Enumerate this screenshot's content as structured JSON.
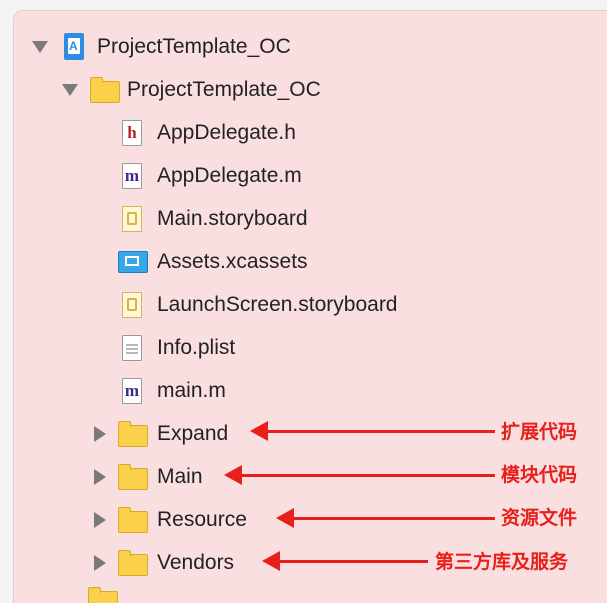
{
  "tree": {
    "project": {
      "label": "ProjectTemplate_OC",
      "icon": "xcode-project-icon"
    },
    "group": {
      "label": "ProjectTemplate_OC",
      "icon": "folder-icon"
    },
    "files": [
      {
        "label": "AppDelegate.h",
        "glyph": "h",
        "icon": "header-file-icon"
      },
      {
        "label": "AppDelegate.m",
        "glyph": "m",
        "icon": "objc-file-icon"
      },
      {
        "label": "Main.storyboard",
        "icon": "storyboard-file-icon"
      },
      {
        "label": "Assets.xcassets",
        "icon": "asset-catalog-icon"
      },
      {
        "label": "LaunchScreen.storyboard",
        "icon": "storyboard-file-icon"
      },
      {
        "label": "Info.plist",
        "icon": "plist-file-icon"
      },
      {
        "label": "main.m",
        "glyph": "m",
        "icon": "objc-file-icon"
      }
    ],
    "folders": [
      {
        "label": "Expand",
        "annotation": "扩展代码"
      },
      {
        "label": "Main",
        "annotation": "模块代码"
      },
      {
        "label": "Resource",
        "annotation": "资源文件"
      },
      {
        "label": "Vendors",
        "annotation": "第三方库及服务"
      }
    ]
  },
  "colors": {
    "panel_bg": "#f9dfe0",
    "annotation_red": "#e8201c",
    "folder_yellow": "#fbd04a"
  }
}
